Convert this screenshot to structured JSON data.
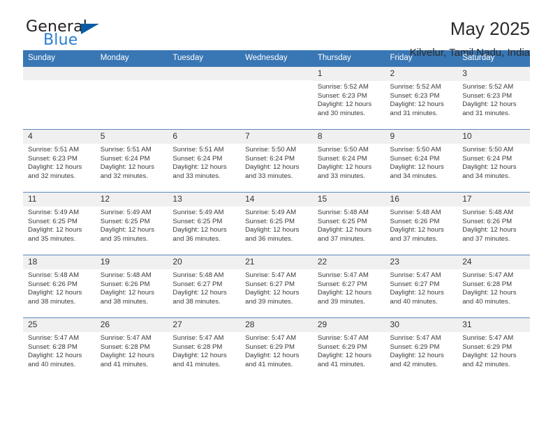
{
  "brand": {
    "word_one": "General",
    "word_two": "Blue",
    "triangle_color": "#0a5ba3",
    "blue_text_color": "#2a7fd4"
  },
  "header": {
    "title": "May 2025",
    "subtitle": "Kilvelur, Tamil Nadu, India"
  },
  "theme": {
    "header_blue": "#3876b4",
    "daynum_gray": "#f0f0f0",
    "grid_line": "#5b87b9"
  },
  "labels": {
    "sunrise_prefix": "Sunrise:",
    "sunset_prefix": "Sunset:",
    "daylight_prefix": "Daylight:"
  },
  "weekdays": [
    "Sunday",
    "Monday",
    "Tuesday",
    "Wednesday",
    "Thursday",
    "Friday",
    "Saturday"
  ],
  "weeks": [
    [
      {
        "day": "",
        "sunrise": "",
        "sunset": "",
        "daylight_line1": "",
        "daylight_line2": ""
      },
      {
        "day": "",
        "sunrise": "",
        "sunset": "",
        "daylight_line1": "",
        "daylight_line2": ""
      },
      {
        "day": "",
        "sunrise": "",
        "sunset": "",
        "daylight_line1": "",
        "daylight_line2": ""
      },
      {
        "day": "",
        "sunrise": "",
        "sunset": "",
        "daylight_line1": "",
        "daylight_line2": ""
      },
      {
        "day": "1",
        "sunrise": "Sunrise: 5:52 AM",
        "sunset": "Sunset: 6:23 PM",
        "daylight_line1": "Daylight: 12 hours",
        "daylight_line2": "and 30 minutes."
      },
      {
        "day": "2",
        "sunrise": "Sunrise: 5:52 AM",
        "sunset": "Sunset: 6:23 PM",
        "daylight_line1": "Daylight: 12 hours",
        "daylight_line2": "and 31 minutes."
      },
      {
        "day": "3",
        "sunrise": "Sunrise: 5:52 AM",
        "sunset": "Sunset: 6:23 PM",
        "daylight_line1": "Daylight: 12 hours",
        "daylight_line2": "and 31 minutes."
      }
    ],
    [
      {
        "day": "4",
        "sunrise": "Sunrise: 5:51 AM",
        "sunset": "Sunset: 6:23 PM",
        "daylight_line1": "Daylight: 12 hours",
        "daylight_line2": "and 32 minutes."
      },
      {
        "day": "5",
        "sunrise": "Sunrise: 5:51 AM",
        "sunset": "Sunset: 6:24 PM",
        "daylight_line1": "Daylight: 12 hours",
        "daylight_line2": "and 32 minutes."
      },
      {
        "day": "6",
        "sunrise": "Sunrise: 5:51 AM",
        "sunset": "Sunset: 6:24 PM",
        "daylight_line1": "Daylight: 12 hours",
        "daylight_line2": "and 33 minutes."
      },
      {
        "day": "7",
        "sunrise": "Sunrise: 5:50 AM",
        "sunset": "Sunset: 6:24 PM",
        "daylight_line1": "Daylight: 12 hours",
        "daylight_line2": "and 33 minutes."
      },
      {
        "day": "8",
        "sunrise": "Sunrise: 5:50 AM",
        "sunset": "Sunset: 6:24 PM",
        "daylight_line1": "Daylight: 12 hours",
        "daylight_line2": "and 33 minutes."
      },
      {
        "day": "9",
        "sunrise": "Sunrise: 5:50 AM",
        "sunset": "Sunset: 6:24 PM",
        "daylight_line1": "Daylight: 12 hours",
        "daylight_line2": "and 34 minutes."
      },
      {
        "day": "10",
        "sunrise": "Sunrise: 5:50 AM",
        "sunset": "Sunset: 6:24 PM",
        "daylight_line1": "Daylight: 12 hours",
        "daylight_line2": "and 34 minutes."
      }
    ],
    [
      {
        "day": "11",
        "sunrise": "Sunrise: 5:49 AM",
        "sunset": "Sunset: 6:25 PM",
        "daylight_line1": "Daylight: 12 hours",
        "daylight_line2": "and 35 minutes."
      },
      {
        "day": "12",
        "sunrise": "Sunrise: 5:49 AM",
        "sunset": "Sunset: 6:25 PM",
        "daylight_line1": "Daylight: 12 hours",
        "daylight_line2": "and 35 minutes."
      },
      {
        "day": "13",
        "sunrise": "Sunrise: 5:49 AM",
        "sunset": "Sunset: 6:25 PM",
        "daylight_line1": "Daylight: 12 hours",
        "daylight_line2": "and 36 minutes."
      },
      {
        "day": "14",
        "sunrise": "Sunrise: 5:49 AM",
        "sunset": "Sunset: 6:25 PM",
        "daylight_line1": "Daylight: 12 hours",
        "daylight_line2": "and 36 minutes."
      },
      {
        "day": "15",
        "sunrise": "Sunrise: 5:48 AM",
        "sunset": "Sunset: 6:25 PM",
        "daylight_line1": "Daylight: 12 hours",
        "daylight_line2": "and 37 minutes."
      },
      {
        "day": "16",
        "sunrise": "Sunrise: 5:48 AM",
        "sunset": "Sunset: 6:26 PM",
        "daylight_line1": "Daylight: 12 hours",
        "daylight_line2": "and 37 minutes."
      },
      {
        "day": "17",
        "sunrise": "Sunrise: 5:48 AM",
        "sunset": "Sunset: 6:26 PM",
        "daylight_line1": "Daylight: 12 hours",
        "daylight_line2": "and 37 minutes."
      }
    ],
    [
      {
        "day": "18",
        "sunrise": "Sunrise: 5:48 AM",
        "sunset": "Sunset: 6:26 PM",
        "daylight_line1": "Daylight: 12 hours",
        "daylight_line2": "and 38 minutes."
      },
      {
        "day": "19",
        "sunrise": "Sunrise: 5:48 AM",
        "sunset": "Sunset: 6:26 PM",
        "daylight_line1": "Daylight: 12 hours",
        "daylight_line2": "and 38 minutes."
      },
      {
        "day": "20",
        "sunrise": "Sunrise: 5:48 AM",
        "sunset": "Sunset: 6:27 PM",
        "daylight_line1": "Daylight: 12 hours",
        "daylight_line2": "and 38 minutes."
      },
      {
        "day": "21",
        "sunrise": "Sunrise: 5:47 AM",
        "sunset": "Sunset: 6:27 PM",
        "daylight_line1": "Daylight: 12 hours",
        "daylight_line2": "and 39 minutes."
      },
      {
        "day": "22",
        "sunrise": "Sunrise: 5:47 AM",
        "sunset": "Sunset: 6:27 PM",
        "daylight_line1": "Daylight: 12 hours",
        "daylight_line2": "and 39 minutes."
      },
      {
        "day": "23",
        "sunrise": "Sunrise: 5:47 AM",
        "sunset": "Sunset: 6:27 PM",
        "daylight_line1": "Daylight: 12 hours",
        "daylight_line2": "and 40 minutes."
      },
      {
        "day": "24",
        "sunrise": "Sunrise: 5:47 AM",
        "sunset": "Sunset: 6:28 PM",
        "daylight_line1": "Daylight: 12 hours",
        "daylight_line2": "and 40 minutes."
      }
    ],
    [
      {
        "day": "25",
        "sunrise": "Sunrise: 5:47 AM",
        "sunset": "Sunset: 6:28 PM",
        "daylight_line1": "Daylight: 12 hours",
        "daylight_line2": "and 40 minutes."
      },
      {
        "day": "26",
        "sunrise": "Sunrise: 5:47 AM",
        "sunset": "Sunset: 6:28 PM",
        "daylight_line1": "Daylight: 12 hours",
        "daylight_line2": "and 41 minutes."
      },
      {
        "day": "27",
        "sunrise": "Sunrise: 5:47 AM",
        "sunset": "Sunset: 6:28 PM",
        "daylight_line1": "Daylight: 12 hours",
        "daylight_line2": "and 41 minutes."
      },
      {
        "day": "28",
        "sunrise": "Sunrise: 5:47 AM",
        "sunset": "Sunset: 6:29 PM",
        "daylight_line1": "Daylight: 12 hours",
        "daylight_line2": "and 41 minutes."
      },
      {
        "day": "29",
        "sunrise": "Sunrise: 5:47 AM",
        "sunset": "Sunset: 6:29 PM",
        "daylight_line1": "Daylight: 12 hours",
        "daylight_line2": "and 41 minutes."
      },
      {
        "day": "30",
        "sunrise": "Sunrise: 5:47 AM",
        "sunset": "Sunset: 6:29 PM",
        "daylight_line1": "Daylight: 12 hours",
        "daylight_line2": "and 42 minutes."
      },
      {
        "day": "31",
        "sunrise": "Sunrise: 5:47 AM",
        "sunset": "Sunset: 6:29 PM",
        "daylight_line1": "Daylight: 12 hours",
        "daylight_line2": "and 42 minutes."
      }
    ]
  ]
}
